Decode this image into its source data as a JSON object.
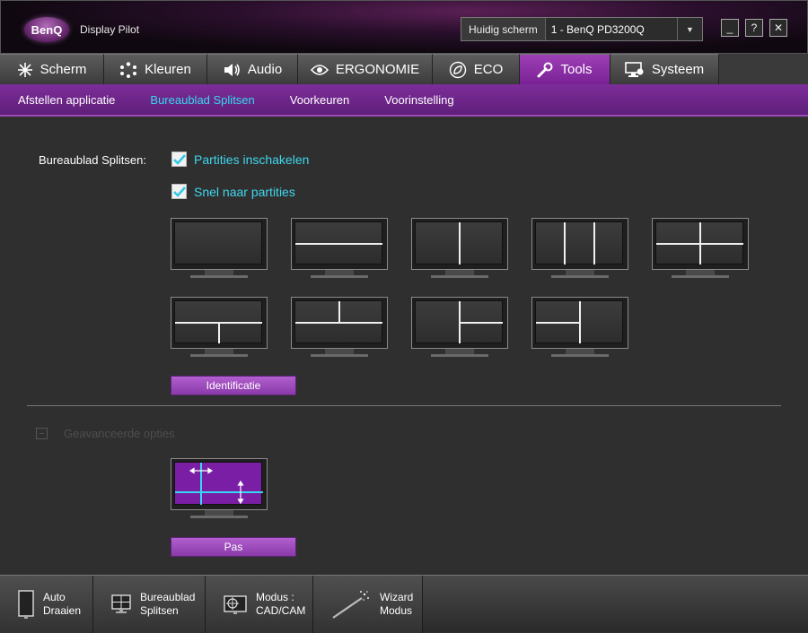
{
  "window": {
    "brand": "BenQ",
    "title": "Display Pilot",
    "monitor_label": "Huidig scherm",
    "monitor_value": "1 - BenQ PD3200Q",
    "minimize": "_",
    "help": "?",
    "close": "✕"
  },
  "tabs": [
    {
      "label": "Scherm",
      "icon": "move-arrows-icon"
    },
    {
      "label": "Kleuren",
      "icon": "color-dots-icon"
    },
    {
      "label": "Audio",
      "icon": "speaker-icon"
    },
    {
      "label": "ERGONOMIE",
      "icon": "eye-icon"
    },
    {
      "label": "ECO",
      "icon": "leaf-icon"
    },
    {
      "label": "Tools",
      "icon": "wrench-icon",
      "active": true
    },
    {
      "label": "Systeem",
      "icon": "monitor-gear-icon"
    }
  ],
  "subtabs": [
    {
      "label": "Afstellen applicatie"
    },
    {
      "label": "Bureaublad Splitsen",
      "active": true
    },
    {
      "label": "Voorkeuren"
    },
    {
      "label": "Voorinstelling"
    }
  ],
  "content": {
    "section_label": "Bureaublad Splitsen:",
    "enable_partitions": "Partities inschakelen",
    "snap_partitions": "Snel naar partities",
    "identify_button": "Identificatie",
    "advanced_label": "Geavanceerde opties",
    "advanced_toggle": "−",
    "apply_button": "Pas"
  },
  "bottom_bar": [
    {
      "label": "Auto\nDraaien",
      "icon": "rotate-monitor-icon"
    },
    {
      "label": "Bureaublad\nSplitsen",
      "icon": "split-desktop-icon"
    },
    {
      "label": "Modus :\nCAD/CAM",
      "icon": "cad-cam-icon"
    },
    {
      "label": "Wizard\nModus",
      "icon": "wand-icon"
    }
  ],
  "colors": {
    "accent_purple": "#7a2196",
    "active_cyan": "#35d9f1"
  }
}
